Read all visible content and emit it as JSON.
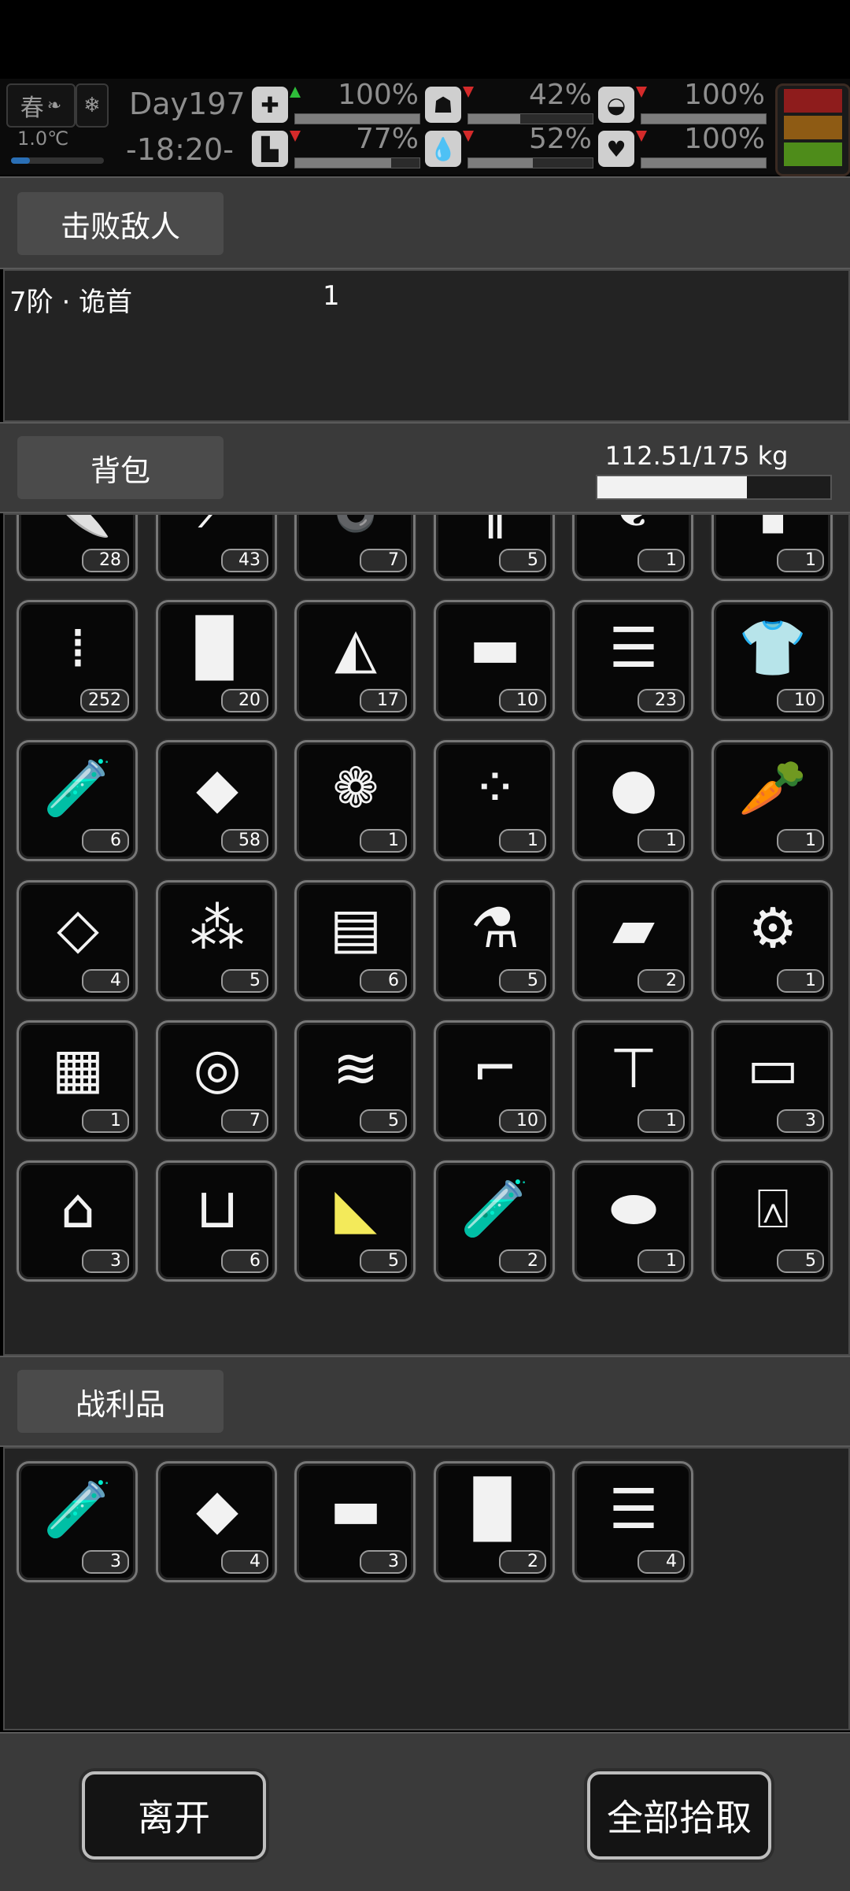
{
  "hud": {
    "season": "春",
    "temperature": "1.0℃",
    "day": "Day197",
    "time": "-18:20-",
    "stats": [
      {
        "icon": "medkit-icon",
        "glyph": "✚",
        "value": "100%",
        "level": 1.0,
        "trend": "up"
      },
      {
        "icon": "stomach-icon",
        "glyph": "☗",
        "value": "42%",
        "level": 0.42,
        "trend": "down"
      },
      {
        "icon": "mask-icon",
        "glyph": "◒",
        "value": "100%",
        "level": 1.0,
        "trend": "down"
      },
      {
        "icon": "boot-icon",
        "glyph": "▙",
        "value": "77%",
        "level": 0.77,
        "trend": "down"
      },
      {
        "icon": "water-drop-icon",
        "glyph": "💧",
        "value": "52%",
        "level": 0.52,
        "trend": "down"
      },
      {
        "icon": "heart-icon",
        "glyph": "♥",
        "value": "100%",
        "level": 1.0,
        "trend": "down"
      }
    ],
    "status_colors": [
      "#8e1c1c",
      "#8e5b14",
      "#4e8c1a"
    ]
  },
  "enemy_panel": {
    "title": "击败敌人",
    "enemy_name": "7阶 · 诡首",
    "enemy_count": "1"
  },
  "backpack": {
    "title": "背包",
    "weight": "112.51/175 kg",
    "weight_fraction": 0.643,
    "items": [
      {
        "name": "knife-icon",
        "glyph": "🔪",
        "count": "28"
      },
      {
        "name": "screwdriver-icon",
        "glyph": "⟋",
        "count": "43"
      },
      {
        "name": "rope-icon",
        "glyph": "➰",
        "count": "7"
      },
      {
        "name": "needles-icon",
        "glyph": "∥",
        "count": "5"
      },
      {
        "name": "wet-cloth-icon",
        "glyph": "❦",
        "count": "1"
      },
      {
        "name": "scarf-icon",
        "glyph": "▮",
        "count": "1"
      },
      {
        "name": "bullets-icon",
        "glyph": "⁞",
        "count": "252"
      },
      {
        "name": "cloth-icon",
        "glyph": "▉",
        "count": "20"
      },
      {
        "name": "rag-icon",
        "glyph": "◭",
        "count": "17"
      },
      {
        "name": "towel-icon",
        "glyph": "▬",
        "count": "10"
      },
      {
        "name": "folded-clothes-icon",
        "glyph": "☰",
        "count": "23"
      },
      {
        "name": "tattered-shirt-icon",
        "glyph": "👕",
        "count": "10"
      },
      {
        "name": "test-tube-vii-icon",
        "glyph": "🧪",
        "count": "6"
      },
      {
        "name": "food-bag-icon",
        "glyph": "◆",
        "count": "58"
      },
      {
        "name": "seeds-icon",
        "glyph": "❁",
        "count": "1"
      },
      {
        "name": "beans-icon",
        "glyph": "⁘",
        "count": "1"
      },
      {
        "name": "egg-icon",
        "glyph": "●",
        "count": "1"
      },
      {
        "name": "carrots-icon",
        "glyph": "🥕",
        "count": "1"
      },
      {
        "name": "glass-shards-icon",
        "glyph": "◇",
        "count": "4"
      },
      {
        "name": "rubble-icon",
        "glyph": "⁂",
        "count": "5"
      },
      {
        "name": "planks-icon",
        "glyph": "▤",
        "count": "6"
      },
      {
        "name": "spray-bottle-icon",
        "glyph": "⚗",
        "count": "5"
      },
      {
        "name": "brick-icon",
        "glyph": "▰",
        "count": "2"
      },
      {
        "name": "parts-icon",
        "glyph": "⚙",
        "count": "1"
      },
      {
        "name": "blocks-icon",
        "glyph": "▦",
        "count": "1"
      },
      {
        "name": "paper-roll-icon",
        "glyph": "◎",
        "count": "7"
      },
      {
        "name": "wires-icon",
        "glyph": "≋",
        "count": "5"
      },
      {
        "name": "pipes-icon",
        "glyph": "⌐",
        "count": "10"
      },
      {
        "name": "screws-icon",
        "glyph": "⊤",
        "count": "1"
      },
      {
        "name": "cash-icon",
        "glyph": "▭",
        "count": "3"
      },
      {
        "name": "bottle-icon",
        "glyph": "⌂",
        "count": "3"
      },
      {
        "name": "beaker-icon",
        "glyph": "⊔",
        "count": "6"
      },
      {
        "name": "yellow-cloth-icon",
        "glyph": "◣",
        "count": "5",
        "yellow": true
      },
      {
        "name": "test-tube-v-icon",
        "glyph": "🧪",
        "count": "2"
      },
      {
        "name": "bread-icon",
        "glyph": "⬬",
        "count": "1"
      },
      {
        "name": "water-bottle-icon",
        "glyph": "⍓",
        "count": "5"
      }
    ]
  },
  "loot": {
    "title": "战利品",
    "items": [
      {
        "name": "test-tube-vii-icon",
        "glyph": "🧪",
        "count": "3"
      },
      {
        "name": "food-bag-icon",
        "glyph": "◆",
        "count": "4"
      },
      {
        "name": "towel-icon",
        "glyph": "▬",
        "count": "3"
      },
      {
        "name": "cloth-icon",
        "glyph": "▉",
        "count": "2"
      },
      {
        "name": "folded-clothes-icon",
        "glyph": "☰",
        "count": "4"
      }
    ]
  },
  "actions": {
    "leave": "离开",
    "take_all": "全部拾取"
  }
}
